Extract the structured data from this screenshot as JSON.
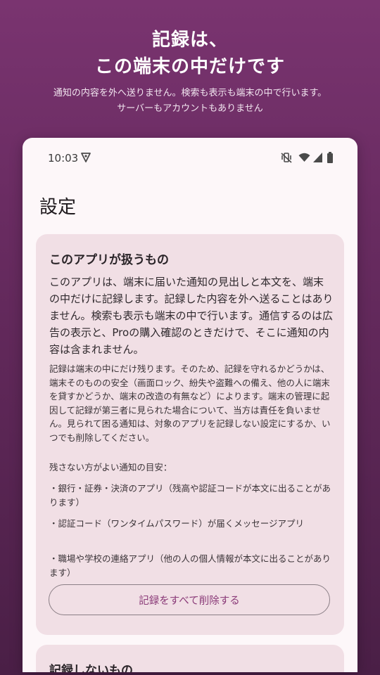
{
  "hero": {
    "title_line1": "記録は、",
    "title_line2": "この端末の中だけです",
    "subtitle_line1": "通知の内容を外へ送りません。検索も表示も端末の中で行います。",
    "subtitle_line2": "サーバーもアカウントもありません"
  },
  "status_bar": {
    "time": "10:03",
    "icons": [
      "shield-icon",
      "mute-vibrate-icon",
      "wifi-icon",
      "signal-icon",
      "battery-icon"
    ]
  },
  "screen": {
    "title": "設定"
  },
  "card": {
    "title": "このアプリが扱うもの",
    "lead": "このアプリは、端末に届いた通知の見出しと本文を、端末の中だけに記録します。記録した内容を外へ送ることはありません。検索も表示も端末の中で行います。通信するのは広告の表示と、Proの購入確認のときだけで、そこに通知の内容は含まれません。",
    "body": "記録は端末の中にだけ残ります。そのため、記録を守れるかどうかは、端末そのものの安全（画面ロック、紛失や盗難への備え、他の人に端末を貸すかどうか、端末の改造の有無など）によります。端末の管理に起因して記録が第三者に見られた場合について、当方は責任を負いません。見られて困る通知は、対象のアプリを記録しない設定にするか、いつでも削除してください。",
    "guide_heading": "残さない方がよい通知の目安：",
    "items": [
      "・銀行・証券・決済のアプリ（残高や認証コードが本文に出ることがあります）",
      "・認証コード（ワンタイムパスワード）が届くメッセージアプリ",
      "・職場や学校の連絡アプリ（他の人の個人情報が本文に出ることがあります）"
    ],
    "delete_button": "記録をすべて削除する"
  },
  "card2": {
    "title": "記録しないもの"
  },
  "colors": {
    "background_top": "#7a3470",
    "background_bottom": "#4a1f46",
    "surface": "#fdf7f9",
    "card": "#f1dfe5",
    "accent": "#8a3a78"
  }
}
